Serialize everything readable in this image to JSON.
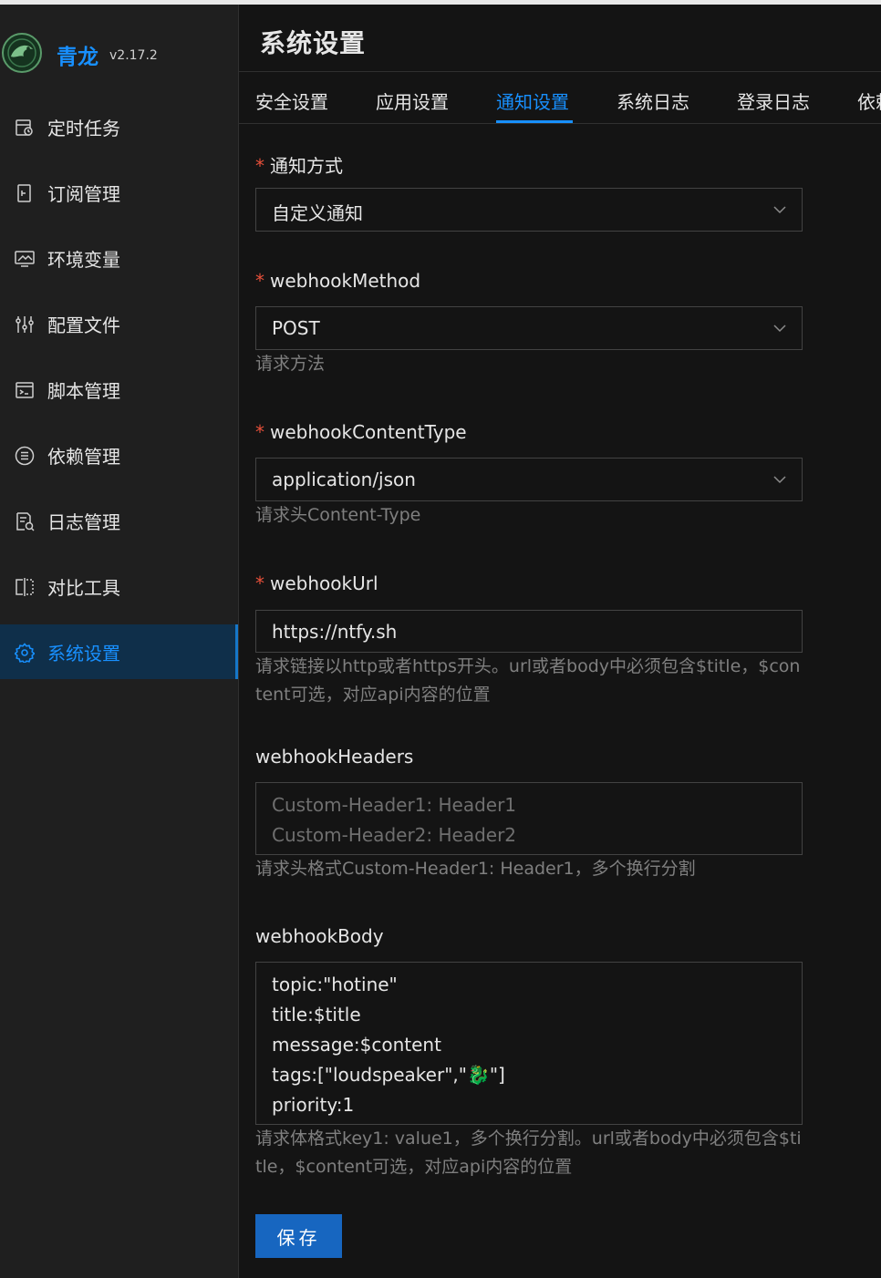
{
  "app": {
    "name": "青龙",
    "version": "v2.17.2"
  },
  "sidebar": {
    "items": [
      {
        "label": "定时任务",
        "icon": "calendar-clock-icon"
      },
      {
        "label": "订阅管理",
        "icon": "subscription-icon"
      },
      {
        "label": "环境变量",
        "icon": "monitor-icon"
      },
      {
        "label": "配置文件",
        "icon": "sliders-icon"
      },
      {
        "label": "脚本管理",
        "icon": "terminal-icon"
      },
      {
        "label": "依赖管理",
        "icon": "list-icon"
      },
      {
        "label": "日志管理",
        "icon": "log-file-icon"
      },
      {
        "label": "对比工具",
        "icon": "diff-icon"
      },
      {
        "label": "系统设置",
        "icon": "gear-icon",
        "active": true
      }
    ]
  },
  "page": {
    "title": "系统设置"
  },
  "tabs": [
    {
      "label": "安全设置"
    },
    {
      "label": "应用设置"
    },
    {
      "label": "通知设置",
      "active": true
    },
    {
      "label": "系统日志"
    },
    {
      "label": "登录日志"
    },
    {
      "label": "依赖"
    }
  ],
  "form": {
    "notify_method": {
      "label": "通知方式",
      "required": true,
      "value": "自定义通知"
    },
    "webhook_method": {
      "label": "webhookMethod",
      "required": true,
      "value": "POST",
      "help": "请求方法"
    },
    "webhook_content_type": {
      "label": "webhookContentType",
      "required": true,
      "value": "application/json",
      "help": "请求头Content-Type"
    },
    "webhook_url": {
      "label": "webhookUrl",
      "required": true,
      "value": "https://ntfy.sh",
      "help": "请求链接以http或者https开头。url或者body中必须包含$title，$content可选，对应api内容的位置"
    },
    "webhook_headers": {
      "label": "webhookHeaders",
      "placeholder_lines": [
        "Custom-Header1: Header1",
        "Custom-Header2: Header2"
      ],
      "help": "请求头格式Custom-Header1: Header1，多个换行分割"
    },
    "webhook_body": {
      "label": "webhookBody",
      "lines": [
        "topic:\"hotine\"",
        "title:$title",
        "message:$content",
        "tags:[\"loudspeaker\",\"🐉\"]",
        "priority:1"
      ],
      "help": "请求体格式key1: value1，多个换行分割。url或者body中必须包含$title，$content可选，对应api内容的位置"
    },
    "save_label": "保存"
  },
  "colors": {
    "accent": "#1890ff",
    "required": "#e8503a",
    "background": "#141414",
    "sidebar": "#1f1f1f"
  }
}
